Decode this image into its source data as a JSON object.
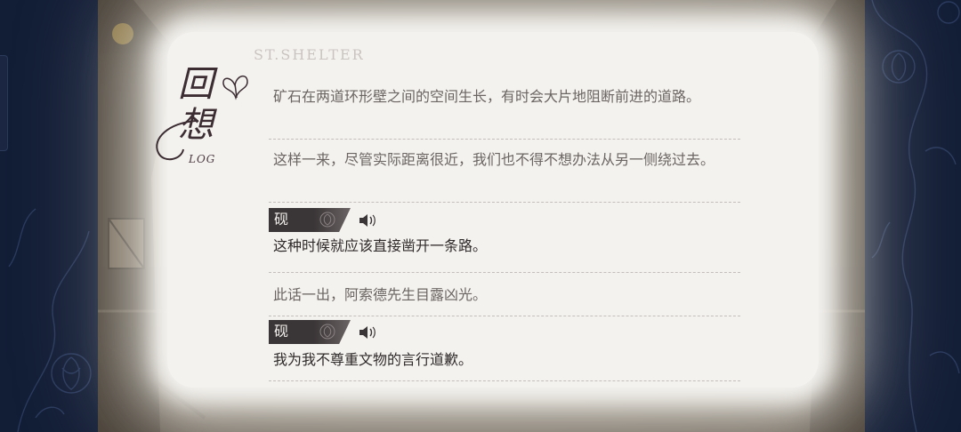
{
  "watermark": "ST.SHELTER",
  "title": {
    "main": "回想",
    "sub": "LOG"
  },
  "entries": [
    {
      "text": "矿石在两道环形壁之间的空间生长，有时会大片地阻断前进的道路。"
    },
    {
      "text": "这样一来，尽管实际距离很近，我们也不得不想办法从另一侧绕过去。"
    },
    {
      "speaker": "砚",
      "text": "这种时候就应该直接凿开一条路。"
    },
    {
      "text": "此话一出，阿索德先生目露凶光。"
    },
    {
      "speaker": "砚",
      "text": "我为我不尊重文物的言行道歉。"
    }
  ],
  "colors": {
    "side_panel": "#121d36",
    "paper": "#f4f2ef",
    "speaker_tag": "#3a3536",
    "text": "#2e2a2a",
    "narration_text": "#6a6562"
  },
  "icons": [
    "butterfly-icon",
    "speaker-voice-icon",
    "rose-ornament-icon"
  ]
}
